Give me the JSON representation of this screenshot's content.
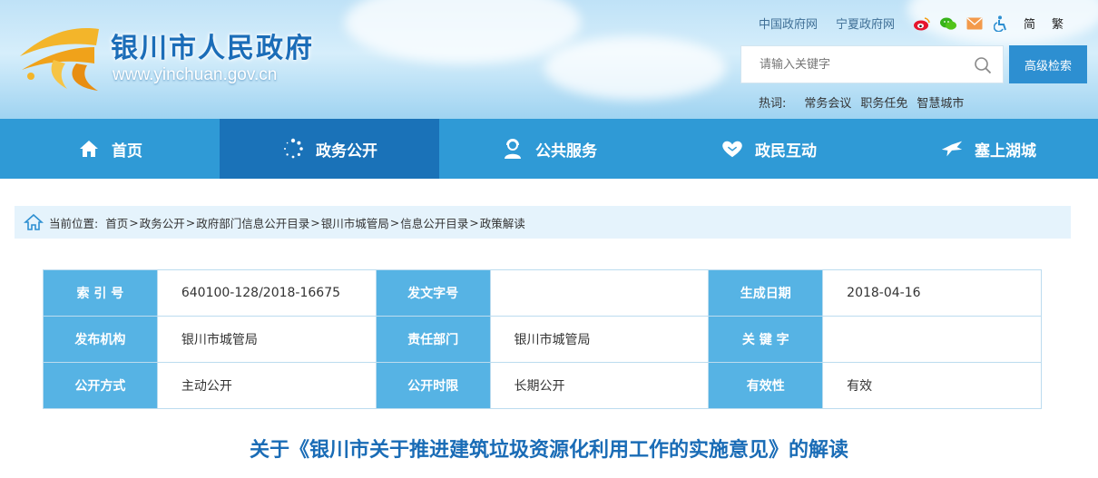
{
  "header": {
    "site_name": "银川市人民政府",
    "site_url": "www.yinchuan.gov.cn",
    "top_links": [
      "中国政府网",
      "宁夏政府网"
    ],
    "icons": [
      "weibo-icon",
      "wechat-icon",
      "mail-icon",
      "accessibility-icon"
    ],
    "lang_simplified": "简",
    "lang_traditional": "繁",
    "search_placeholder": "请输入关键字",
    "advanced_search": "高级检索",
    "hot_label": "热词:",
    "hot_words": [
      "常务会议",
      "职务任免",
      "智慧城市"
    ]
  },
  "nav": [
    {
      "label": "首页",
      "icon": "home-icon"
    },
    {
      "label": "政务公开",
      "icon": "dots-ring-icon",
      "active": true
    },
    {
      "label": "公共服务",
      "icon": "user-service-icon"
    },
    {
      "label": "政民互动",
      "icon": "heart-hands-icon"
    },
    {
      "label": "塞上湖城",
      "icon": "bird-icon"
    }
  ],
  "breadcrumb": {
    "label": "当前位置:",
    "items": [
      "首页",
      "政务公开",
      "政府部门信息公开目录",
      "银川市城管局",
      "信息公开目录",
      "政策解读"
    ],
    "separator": ">"
  },
  "info_table": {
    "rows": [
      [
        {
          "key": "索 引 号",
          "value": "640100-128/2018-16675"
        },
        {
          "key": "发文字号",
          "value": ""
        },
        {
          "key": "生成日期",
          "value": "2018-04-16"
        }
      ],
      [
        {
          "key": "发布机构",
          "value": "银川市城管局"
        },
        {
          "key": "责任部门",
          "value": "银川市城管局"
        },
        {
          "key": "关 键 字",
          "value": ""
        }
      ],
      [
        {
          "key": "公开方式",
          "value": "主动公开"
        },
        {
          "key": "公开时限",
          "value": "长期公开"
        },
        {
          "key": "有效性",
          "value": "有效"
        }
      ]
    ]
  },
  "article_title": "关于《银川市关于推进建筑垃圾资源化利用工作的实施意见》的解读",
  "colors": {
    "nav_bg": "#2f9ad6",
    "nav_active": "#1a72b8",
    "table_key_bg": "#56b3e4",
    "title": "#1a6cb6",
    "breadcrumb_bg": "#e5f3fc"
  }
}
